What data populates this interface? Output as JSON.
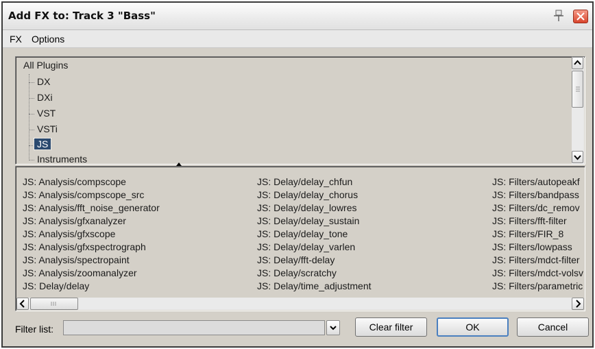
{
  "window": {
    "title": "Add FX to: Track 3 \"Bass\""
  },
  "menu": {
    "items": [
      "FX",
      "Options"
    ]
  },
  "tree": {
    "root": "All Plugins",
    "children": [
      "DX",
      "DXi",
      "VST",
      "VSTi",
      "JS",
      "Instruments"
    ],
    "selected": "JS"
  },
  "plugins": {
    "columns": [
      [
        "JS: Analysis/compscope",
        "JS: Analysis/compscope_src",
        "JS: Analysis/fft_noise_generator",
        "JS: Analysis/gfxanalyzer",
        "JS: Analysis/gfxscope",
        "JS: Analysis/gfxspectrograph",
        "JS: Analysis/spectropaint",
        "JS: Analysis/zoomanalyzer",
        "JS: Delay/delay"
      ],
      [
        "JS: Delay/delay_chfun",
        "JS: Delay/delay_chorus",
        "JS: Delay/delay_lowres",
        "JS: Delay/delay_sustain",
        "JS: Delay/delay_tone",
        "JS: Delay/delay_varlen",
        "JS: Delay/fft-delay",
        "JS: Delay/scratchy",
        "JS: Delay/time_adjustment"
      ],
      [
        "JS: Filters/autopeakf",
        "JS: Filters/bandpass",
        "JS: Filters/dc_remov",
        "JS: Filters/fft-filter",
        "JS: Filters/FIR_8",
        "JS: Filters/lowpass",
        "JS: Filters/mdct-filter",
        "JS: Filters/mdct-volsv",
        "JS: Filters/parametric"
      ]
    ]
  },
  "footer": {
    "filter_label": "Filter list:",
    "filter_value": "",
    "clear_label": "Clear filter",
    "ok_label": "OK",
    "cancel_label": "Cancel"
  },
  "colors": {
    "selection": "#2b4a6f",
    "close": "#d9452d",
    "default_button_border": "#4a7fbf"
  },
  "icons": [
    "pin-icon",
    "close-icon",
    "chevron-up-icon",
    "chevron-down-icon",
    "chevron-left-icon",
    "chevron-right-icon",
    "resize-vertical-icon"
  ]
}
